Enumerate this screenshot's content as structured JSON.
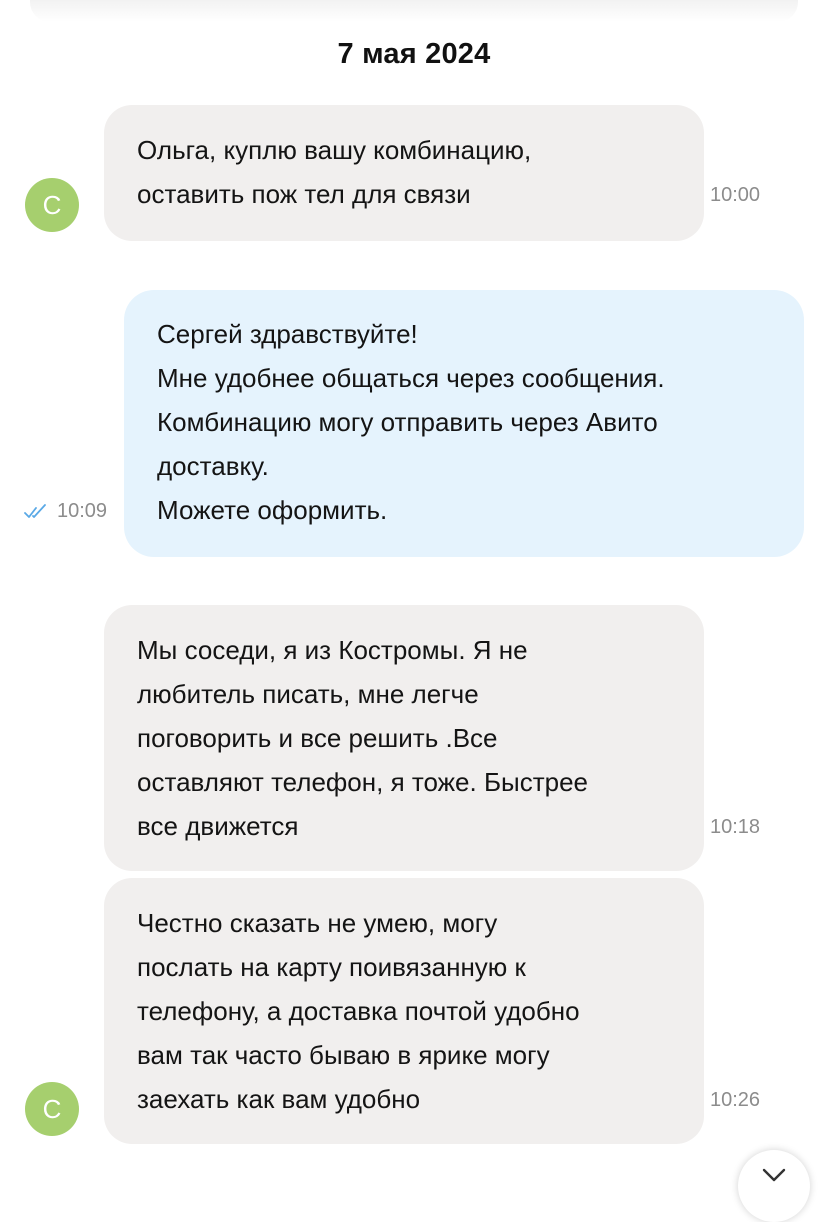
{
  "chat": {
    "date": "7 мая 2024",
    "avatar_letter": "С",
    "messages": [
      {
        "direction": "incoming",
        "text": "Ольга, куплю вашу комбинацию,\nоставить пож тел для связи",
        "time": "10:00"
      },
      {
        "direction": "outgoing",
        "text": "Сергей здравствуйте!\nМне удобнее общаться через сообщения.\nКомбинацию могу отправить через Авито\nдоставку.\nМожете оформить.",
        "time": "10:09",
        "status_icon": "double-check-icon"
      },
      {
        "direction": "incoming",
        "text": "Мы соседи, я из Костромы. Я не\nлюбитель писать, мне легче\nпоговорить и все решить  .Все\nоставляют телефон, я тоже. Быстрее\nвсе движется",
        "time": "10:18"
      },
      {
        "direction": "incoming",
        "text": "Честно сказать не умею, могу\nпослать на карту поивязанную к\nтелефону, а доставка почтой удобно\nвам так часто бываю в ярике могу\nзаехать как вам удобно",
        "time": "10:26"
      }
    ]
  },
  "colors": {
    "avatar": "#a6cf6e",
    "incoming_bubble": "#f1efee",
    "outgoing_bubble": "#e5f3fd",
    "read_check": "#5aa9e6",
    "time_text": "#8c8c8c"
  },
  "icons": {
    "read_status": "double-check-icon",
    "scroll_down": "chevron-down-icon"
  }
}
